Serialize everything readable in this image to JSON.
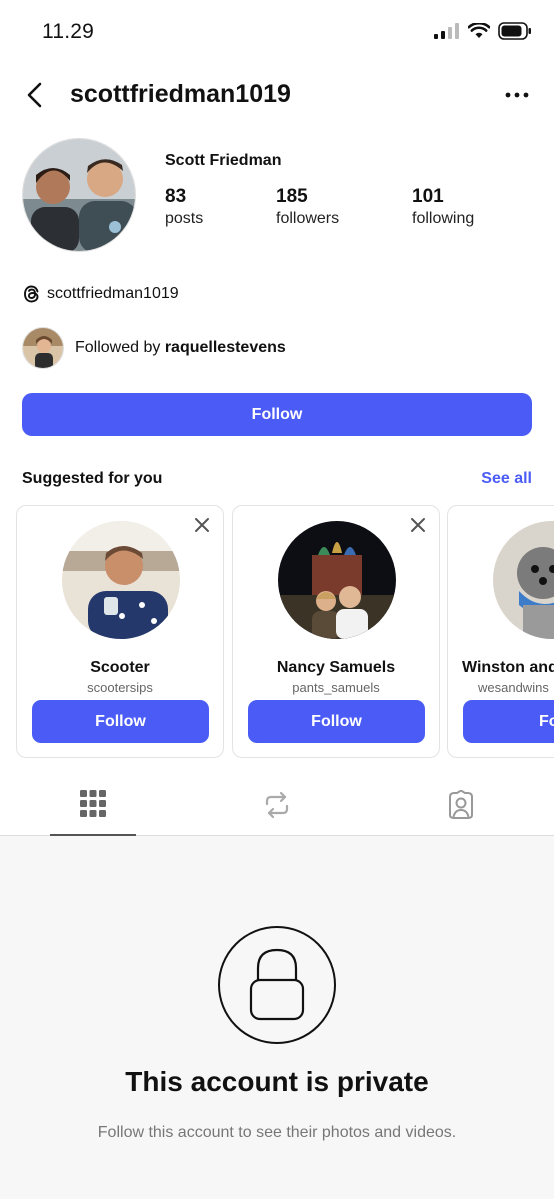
{
  "status": {
    "time": "11.29"
  },
  "header": {
    "username": "scottfriedman1019"
  },
  "profile": {
    "display_name": "Scott Friedman",
    "stats": [
      {
        "value": "83",
        "label": "posts"
      },
      {
        "value": "185",
        "label": "followers"
      },
      {
        "value": "101",
        "label": "following"
      }
    ],
    "threads_handle": "scottfriedman1019",
    "followed_by_prefix": "Followed by ",
    "followed_by_user": "raquellestevens",
    "follow_label": "Follow"
  },
  "suggested": {
    "title": "Suggested for you",
    "see_all": "See all",
    "cards": [
      {
        "name": "Scooter",
        "handle": "scootersips",
        "button": "Follow"
      },
      {
        "name": "Nancy Samuels",
        "handle": "pants_samuels",
        "button": "Follow"
      },
      {
        "name": "Winston and",
        "handle": "wesandwins",
        "button": "Foll"
      }
    ]
  },
  "tabs": [
    "grid-icon",
    "reposts-icon",
    "tagged-icon"
  ],
  "private": {
    "title": "This account is private",
    "subtitle": "Follow this account to see their photos and videos."
  },
  "colors": {
    "accent": "#4a5cf5"
  }
}
